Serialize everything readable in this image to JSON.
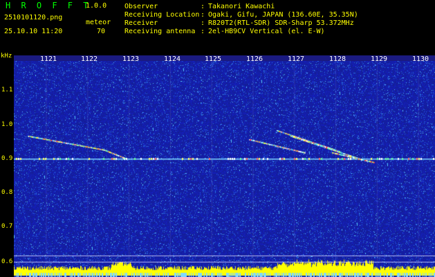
{
  "header": {
    "app_title": "H R O F F T",
    "app_version": "1.0.0",
    "file_name": "2510101120.png",
    "meteor_label": "meteor",
    "date_time": "25.10.10 11:20",
    "meteor_count": "70",
    "info": [
      {
        "key": "Observer",
        "value": "Takanori Kawachi"
      },
      {
        "key": "Receiving Location",
        "value": "Ogaki, Gifu, JAPAN (136.60E, 35.35N)"
      },
      {
        "key": "Receiver",
        "value": "R820T2(RTL-SDR) SDR-Sharp 53.372MHz"
      },
      {
        "key": "Receiving antenna",
        "value": "2el-HB9CV Vertical (el. E-W)"
      }
    ],
    "separator": ":"
  },
  "axes": {
    "y_unit": "kHz",
    "y_ticks": [
      "1.1",
      "1.0",
      "0.9",
      "0.8",
      "0.7",
      "0.6"
    ],
    "x_ticks": [
      "1121",
      "1122",
      "1123",
      "1124",
      "1125",
      "1126",
      "1127",
      "1128",
      "1129",
      "1130"
    ]
  },
  "colors": {
    "background": "#000000",
    "spectrogram_base": "#1b2a9a",
    "header_text": "#ffff00",
    "title_green": "#00ff00",
    "carrier_line": "#7fd8ff",
    "noise_floor": "#ffff00"
  }
}
